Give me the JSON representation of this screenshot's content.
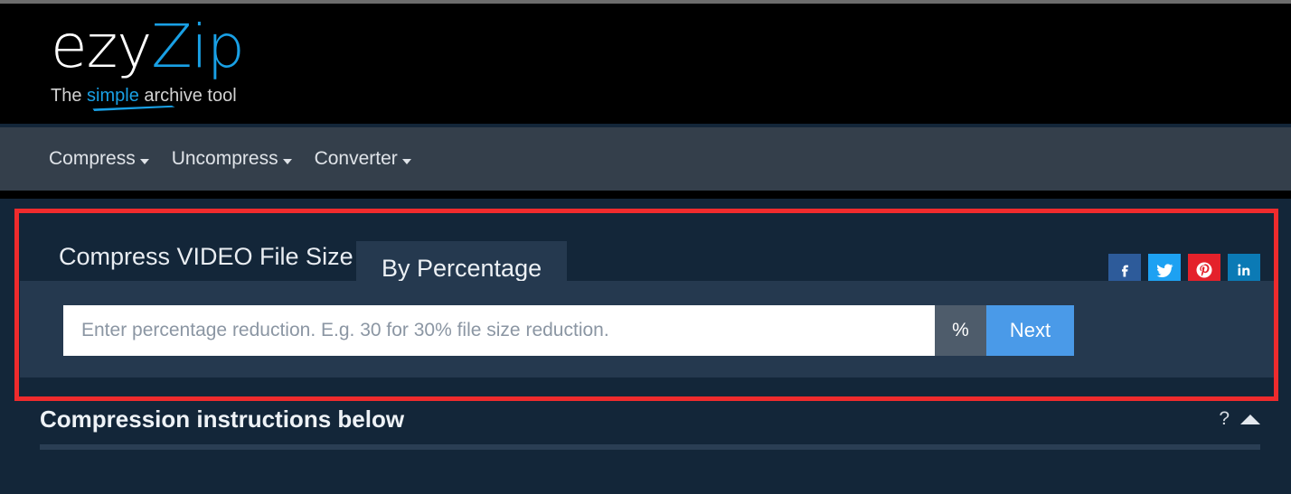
{
  "site": {
    "logo_primary": "ezy",
    "logo_accent": "Zip",
    "tagline_before": "The ",
    "tagline_accent": "simple",
    "tagline_after": " archive tool"
  },
  "nav": {
    "items": [
      {
        "label": "Compress",
        "icon": "chevron-down-icon"
      },
      {
        "label": "Uncompress",
        "icon": "chevron-down-icon"
      },
      {
        "label": "Converter",
        "icon": "chevron-down-icon"
      }
    ]
  },
  "card": {
    "title": "Compress VIDEO File Size",
    "active_tab": "By Percentage",
    "socials": [
      {
        "name": "facebook",
        "label": "f",
        "color": "#2d5b9a"
      },
      {
        "name": "twitter",
        "label": "t",
        "color": "#1da1f2"
      },
      {
        "name": "pinterest",
        "label": "p",
        "color": "#e4212b"
      },
      {
        "name": "linkedin",
        "label": "in",
        "color": "#0b7ab5"
      }
    ],
    "input": {
      "value": "",
      "placeholder": "Enter percentage reduction. E.g. 30 for 30% file size reduction.",
      "suffix": "%",
      "next_label": "Next"
    }
  },
  "instructions": {
    "title": "Compression instructions below",
    "help_label": "?",
    "collapse_icon": "caret-up-icon"
  },
  "colors": {
    "accent_blue": "#19a0e5",
    "button_blue": "#4a9ae8",
    "page_bg": "#132639",
    "panel_bg": "#25394f",
    "nav_bg": "#343f4b",
    "annotation_red": "#ef2b2d"
  }
}
